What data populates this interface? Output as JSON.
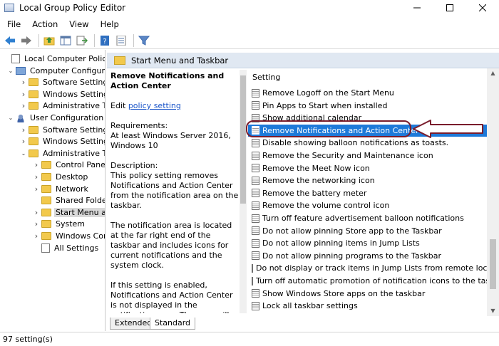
{
  "window": {
    "title": "Local Group Policy Editor",
    "minimize_icon": "minimize-icon",
    "maximize_icon": "maximize-icon",
    "close_icon": "close-icon"
  },
  "menu": [
    "File",
    "Action",
    "View",
    "Help"
  ],
  "toolbar": [
    "back-arrow-icon",
    "forward-arrow-icon",
    "up-folder-icon",
    "show-hide-tree-icon",
    "export-list-icon",
    "help-icon",
    "properties-icon",
    "filter-icon"
  ],
  "tree": {
    "items": [
      {
        "label": "Local Computer Policy",
        "icon": "document",
        "indent": 0,
        "chevron": ""
      },
      {
        "label": "Computer Configurat",
        "icon": "computer",
        "indent": 1,
        "chevron": "down"
      },
      {
        "label": "Software Settings",
        "icon": "folder",
        "indent": 2,
        "chevron": "right"
      },
      {
        "label": "Windows Settings",
        "icon": "folder",
        "indent": 2,
        "chevron": "right"
      },
      {
        "label": "Administrative Te",
        "icon": "folder",
        "indent": 2,
        "chevron": "right"
      },
      {
        "label": "User Configuration",
        "icon": "user",
        "indent": 1,
        "chevron": "down"
      },
      {
        "label": "Software Settings",
        "icon": "folder",
        "indent": 2,
        "chevron": "right"
      },
      {
        "label": "Windows Settings",
        "icon": "folder",
        "indent": 2,
        "chevron": "right"
      },
      {
        "label": "Administrative Te",
        "icon": "folder",
        "indent": 2,
        "chevron": "down"
      },
      {
        "label": "Control Panel",
        "icon": "folder",
        "indent": 3,
        "chevron": "right"
      },
      {
        "label": "Desktop",
        "icon": "folder",
        "indent": 3,
        "chevron": "right"
      },
      {
        "label": "Network",
        "icon": "folder",
        "indent": 3,
        "chevron": "right"
      },
      {
        "label": "Shared Folder",
        "icon": "folder",
        "indent": 3,
        "chevron": ""
      },
      {
        "label": "Start Menu ar",
        "icon": "folder",
        "indent": 3,
        "chevron": "right",
        "selected": true
      },
      {
        "label": "System",
        "icon": "folder",
        "indent": 3,
        "chevron": "right"
      },
      {
        "label": "Windows Con",
        "icon": "folder",
        "indent": 3,
        "chevron": "right"
      },
      {
        "label": "All Settings",
        "icon": "allsettings",
        "indent": 3,
        "chevron": ""
      }
    ]
  },
  "pane": {
    "header": "Start Menu and Taskbar"
  },
  "description": {
    "title": "Remove Notifications and Action Center",
    "edit_prefix": "Edit ",
    "edit_link": "policy setting",
    "req_label": "Requirements:",
    "req_value": "At least Windows Server 2016, Windows 10",
    "desc_label": "Description:",
    "desc_p1": "This policy setting removes Notifications and Action Center from the notification area on the taskbar.",
    "desc_p2": "The notification area is located at the far right end of the taskbar and includes icons for current notifications and the system clock.",
    "desc_p3": "If this setting is enabled, Notifications and Action Center is not displayed in the notification area. The user will be able to read"
  },
  "settings": {
    "column_header": "Setting",
    "items": [
      "Remove Logoff on the Start Menu",
      "Pin Apps to Start when installed",
      "Show additional calendar",
      "Remove Notifications and Action Center",
      "Disable showing balloon notifications as toasts.",
      "Remove the Security and Maintenance icon",
      "Remove the Meet Now icon",
      "Remove the networking icon",
      "Remove the battery meter",
      "Remove the volume control icon",
      "Turn off feature advertisement balloon notifications",
      "Do not allow pinning Store app to the Taskbar",
      "Do not allow pinning items in Jump Lists",
      "Do not allow pinning programs to the Taskbar",
      "Do not display or track items in Jump Lists from remote locati...",
      "Turn off automatic promotion of notification icons to the tas...",
      "Show Windows Store apps on the taskbar",
      "Lock all taskbar settings"
    ],
    "selected_index": 3
  },
  "tabs": [
    "Extended",
    "Standard"
  ],
  "status": "97 setting(s)",
  "colors": {
    "selection": "#1e7ad9",
    "annotation": "#7a1d2c",
    "link": "#1a55c9"
  }
}
